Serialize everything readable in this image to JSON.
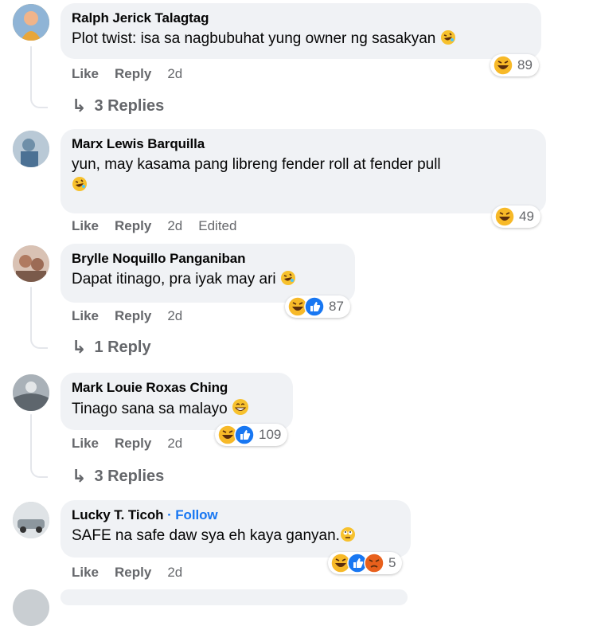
{
  "comments": [
    {
      "author": "Ralph Jerick Talagtag",
      "text": "Plot twist: isa sa nagbubuhat yung owner ng sasakyan",
      "actions": {
        "like": "Like",
        "reply": "Reply",
        "time": "2d"
      },
      "reaction_count": "89",
      "replies": "3 Replies",
      "avatar_color": "#d9a441"
    },
    {
      "author": "Marx Lewis Barquilla",
      "text": "yun, may kasama pang libreng fender roll at fender pull",
      "actions": {
        "like": "Like",
        "reply": "Reply",
        "time": "2d",
        "edited": "Edited"
      },
      "reaction_count": "49",
      "avatar_color": "#6f8fa8"
    },
    {
      "author": "Brylle Noquillo Panganiban",
      "text": "Dapat itinago, pra iyak may ari",
      "actions": {
        "like": "Like",
        "reply": "Reply",
        "time": "2d"
      },
      "reaction_count": "87",
      "replies": "1 Reply",
      "avatar_color": "#b07a60"
    },
    {
      "author": "Mark Louie Roxas Ching",
      "text": "Tinago sana sa malayo",
      "actions": {
        "like": "Like",
        "reply": "Reply",
        "time": "2d"
      },
      "reaction_count": "109",
      "replies": "3 Replies",
      "avatar_color": "#7d858c"
    },
    {
      "author": "Lucky T. Ticoh",
      "follow": "Follow",
      "separator": "·",
      "text": "SAFE na safe daw sya eh kaya ganyan.",
      "actions": {
        "like": "Like",
        "reply": "Reply",
        "time": "2d"
      },
      "reaction_count": "5",
      "avatar_color": "#9aa5ad"
    }
  ],
  "colors": {
    "bubble": "#f0f2f5",
    "meta": "#65676b",
    "link": "#1877f2"
  }
}
